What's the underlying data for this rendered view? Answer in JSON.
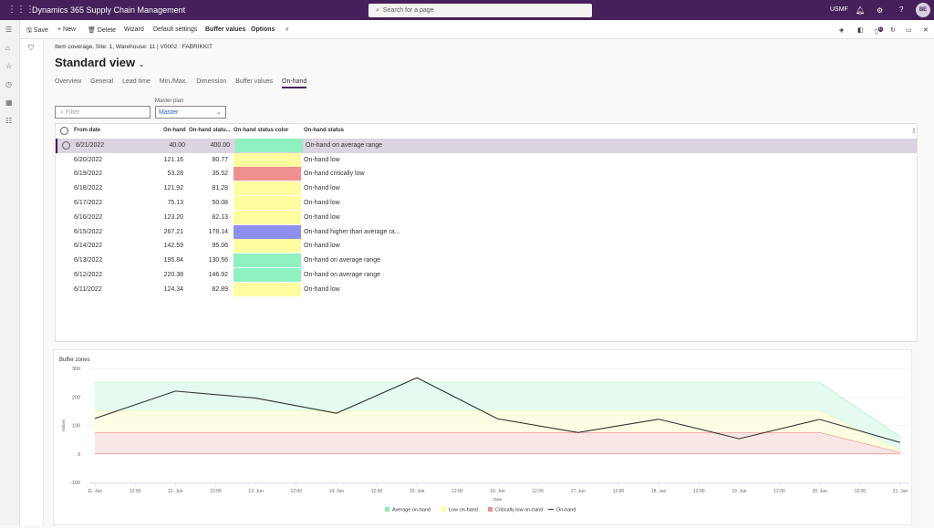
{
  "app": {
    "title": "Dynamics 365 Supply Chain Management",
    "search_placeholder": "Search for a page",
    "company": "USMF",
    "avatar": "BE",
    "notif_count": "0"
  },
  "toolbar": {
    "save": "Save",
    "new": "New",
    "delete": "Delete",
    "wizard": "Wizard",
    "default_settings": "Default settings",
    "buffer_values": "Buffer values",
    "options": "Options"
  },
  "page": {
    "breadcrumb": "Item coverage, Site: 1, Warehouse: 11  |  V0002 : FABRIKKIT",
    "title": "Standard view"
  },
  "tabs": [
    "Overview",
    "General",
    "Lead time",
    "Min./Max.",
    "Dimension",
    "Buffer values",
    "On-hand"
  ],
  "active_tab": "On-hand",
  "filter": {
    "placeholder": "Filter"
  },
  "master_plan": {
    "label": "Master plan",
    "value": "Master"
  },
  "grid": {
    "columns": [
      "From date",
      "On-hand",
      "On-hand statu...",
      "On-hand status color",
      "On-hand status"
    ],
    "rows": [
      {
        "date": "6/21/2022",
        "onhand": "40.00",
        "pct": "400.00",
        "color": "#8ff0c0",
        "status": "On-hand on average range"
      },
      {
        "date": "6/20/2022",
        "onhand": "121.16",
        "pct": "80.77",
        "color": "#fdfd9f",
        "status": "On-hand low"
      },
      {
        "date": "6/19/2022",
        "onhand": "53.28",
        "pct": "35.52",
        "color": "#ef8f8f",
        "status": "On-hand critically low"
      },
      {
        "date": "6/18/2022",
        "onhand": "121.92",
        "pct": "81.28",
        "color": "#fdfd9f",
        "status": "On-hand low"
      },
      {
        "date": "6/17/2022",
        "onhand": "75.13",
        "pct": "50.08",
        "color": "#fdfd9f",
        "status": "On-hand low"
      },
      {
        "date": "6/16/2022",
        "onhand": "123.20",
        "pct": "82.13",
        "color": "#fdfd9f",
        "status": "On-hand low"
      },
      {
        "date": "6/15/2022",
        "onhand": "267.21",
        "pct": "178.14",
        "color": "#8f8fef",
        "status": "On-hand higher than average ra..."
      },
      {
        "date": "6/14/2022",
        "onhand": "142.59",
        "pct": "95.06",
        "color": "#fdfd9f",
        "status": "On-hand low"
      },
      {
        "date": "6/13/2022",
        "onhand": "195.84",
        "pct": "130.56",
        "color": "#8ff0c0",
        "status": "On-hand on average range"
      },
      {
        "date": "6/12/2022",
        "onhand": "220.38",
        "pct": "146.92",
        "color": "#8ff0c0",
        "status": "On-hand on average range"
      },
      {
        "date": "6/11/2022",
        "onhand": "124.34",
        "pct": "82.89",
        "color": "#fdfd9f",
        "status": "On-hand low"
      }
    ]
  },
  "chart_data": {
    "type": "area",
    "title": "Buffer zones",
    "xlabel": "Date",
    "ylabel": "Values",
    "ylim": [
      -100,
      300
    ],
    "yticks": [
      300,
      200,
      100,
      0,
      -100
    ],
    "xticks": [
      "11. Jun",
      "12:00",
      "12. Jun",
      "12:00",
      "13. Jun",
      "12:00",
      "14. Jun",
      "12:00",
      "15. Jun",
      "12:00",
      "16. Jun",
      "12:00",
      "17. Jun",
      "12:00",
      "18. Jun",
      "12:00",
      "19. Jun",
      "12:00",
      "20. Jun",
      "12:00",
      "21. Jun"
    ],
    "x": [
      "11. Jun",
      "12. Jun",
      "13. Jun",
      "14. Jun",
      "15. Jun",
      "16. Jun",
      "17. Jun",
      "18. Jun",
      "19. Jun",
      "20. Jun",
      "21. Jun"
    ],
    "grid": true,
    "legend": "bottom",
    "series": [
      {
        "name": "Average on-hand",
        "color": "#90ecb8",
        "values": [
          250,
          250,
          250,
          250,
          250,
          250,
          250,
          250,
          250,
          250,
          60
        ]
      },
      {
        "name": "Low on-hand",
        "color": "#fbfb9c",
        "values": [
          150,
          150,
          150,
          150,
          150,
          150,
          150,
          150,
          150,
          150,
          10
        ]
      },
      {
        "name": "Critically low on-hand",
        "color": "#ee9090",
        "values": [
          75,
          75,
          75,
          75,
          75,
          75,
          75,
          75,
          75,
          75,
          5
        ]
      },
      {
        "name": "On-hand",
        "color": "#323130",
        "values": [
          124.34,
          220.38,
          195.84,
          142.59,
          267.21,
          123.2,
          75.13,
          121.92,
          53.28,
          121.16,
          40.0
        ]
      }
    ]
  }
}
